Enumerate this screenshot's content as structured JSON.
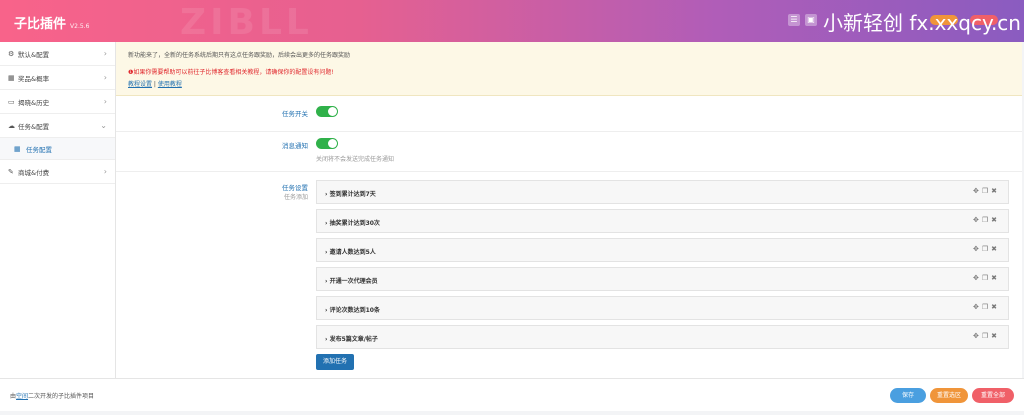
{
  "header": {
    "title": "子比插件",
    "version": "V2.5.6",
    "watermark": "ZIBLL",
    "overlay_text": "小新轻创 fx.xxqcy.cn"
  },
  "sidebar": {
    "items": [
      {
        "label": "默认&配置",
        "icon": "gear-icon"
      },
      {
        "label": "奖品&概率",
        "icon": "calendar-icon"
      },
      {
        "label": "揭晓&历史",
        "icon": "book-icon"
      },
      {
        "label": "任务&配置",
        "icon": "cloud-icon"
      },
      {
        "label": "任务配置",
        "icon": "calendar-icon"
      },
      {
        "label": "商城&付费",
        "icon": "paint-icon"
      }
    ]
  },
  "notice": {
    "line1": "新功能来了，全新的任务系统后期只有这点任务跟奖励，后续会出更多的任务跟奖励",
    "line2": "❶如果你需要帮助可以前往子比博客查看相关教程，请确保你的配置设有问题!",
    "link1": "教程设置",
    "sep": " | ",
    "link2": "使用教程"
  },
  "settings": {
    "task_switch_label": "任务开关",
    "message_notify_label": "消息通知",
    "message_notify_hint": "关闭将不会发送完成任务通知",
    "task_settings_label": "任务设置",
    "task_settings_sub": "任务添加",
    "tasks": [
      "签到累计达到7天",
      "抽奖累计达到30次",
      "邀请人数达到5人",
      "开通一次代理会员",
      "评论次数达到10条",
      "发布5篇文章/帖子"
    ],
    "add_task": "添加任务"
  },
  "footer": {
    "credit_prefix": "由",
    "credit_link": "空间",
    "credit_suffix": "二次开发的子比插件项目",
    "save": "保存",
    "reset_section": "重置选区",
    "reset_all": "重置全部"
  },
  "colors": {
    "accent": "#2271b1",
    "toggle_on": "#30b14a",
    "save": "#4a9fe0",
    "reset_section": "#f0953a",
    "reset_all": "#f06068"
  }
}
